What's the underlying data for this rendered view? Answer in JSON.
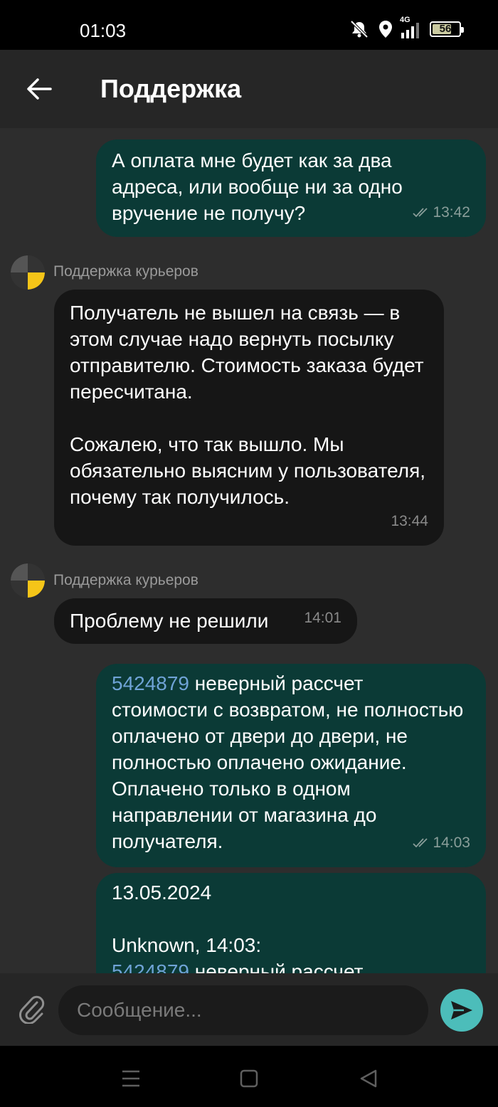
{
  "status_bar": {
    "time": "01:03",
    "network": "4G",
    "battery": "56",
    "icons": [
      "mute-icon",
      "location-icon",
      "signal-icon",
      "battery-icon"
    ]
  },
  "header": {
    "title": "Поддержка",
    "back_icon": "arrow-left-icon"
  },
  "messages": [
    {
      "direction": "outgoing",
      "text": "А оплата мне будет как за два адреса, или вообще ни за одно вручение не получу?",
      "time": "13:42",
      "status": "read"
    },
    {
      "direction": "incoming",
      "sender": "Поддержка курьеров",
      "text": "Получатель не вышел на связь — в этом случае надо вернуть посылку отправителю. Стоимость заказа будет пересчитана.\n\nСожалею, что так вышло. Мы обязательно выясним у пользователя, почему так получилось.",
      "time": "13:44"
    },
    {
      "direction": "incoming",
      "sender": "Поддержка курьеров",
      "text": "Проблему не решили",
      "time": "14:01"
    },
    {
      "direction": "outgoing",
      "link": "5424879",
      "text": " неверный рассчет стоимости с возвратом, не полностью оплачено от двери до двери, не полностью оплачено ожидание. Оплачено только в одном направлении от магазина до получателя.",
      "time": "14:03",
      "status": "read"
    },
    {
      "direction": "outgoing",
      "date": "13.05.2024",
      "quote_author": "Unknown, 14:03:",
      "link": "5424879",
      "text": " неверный рассчет"
    }
  ],
  "composer": {
    "placeholder": "Сообщение...",
    "attach_icon": "paperclip-icon",
    "send_icon": "send-icon"
  },
  "nav_bar": {
    "icons": [
      "menu-icon",
      "home-square-icon",
      "back-triangle-icon"
    ]
  },
  "colors": {
    "background": "#2d2d2d",
    "header": "#262626",
    "outgoing_bubble": "#0b3a36",
    "incoming_bubble": "#161616",
    "link": "#6fa3d6",
    "send_button": "#4cbdba",
    "avatar_accent": "#f5c518"
  }
}
